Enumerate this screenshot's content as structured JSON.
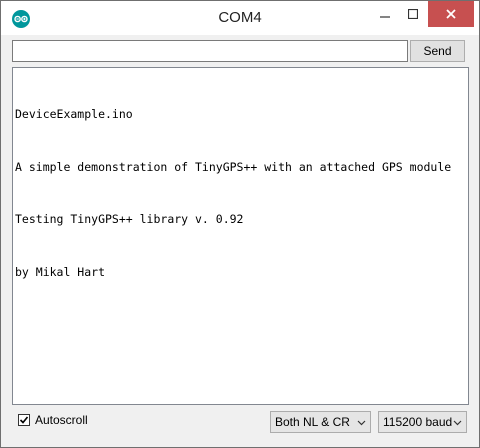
{
  "window": {
    "title": "COM4",
    "icons": {
      "app": "arduino-logo-icon",
      "minimize": "minimize-icon",
      "maximize": "maximize-icon",
      "close": "close-icon"
    },
    "close_color": "#c75050"
  },
  "send_bar": {
    "input_value": "",
    "send_label": "Send"
  },
  "output": {
    "lines": [
      "DeviceExample.ino",
      "A simple demonstration of TinyGPS++ with an attached GPS module",
      "Testing TinyGPS++ library v. 0.92",
      "by Mikal Hart"
    ]
  },
  "footer": {
    "autoscroll_label": "Autoscroll",
    "autoscroll_checked": true,
    "line_ending_value": "Both NL & CR",
    "baud_value": "115200 baud"
  }
}
